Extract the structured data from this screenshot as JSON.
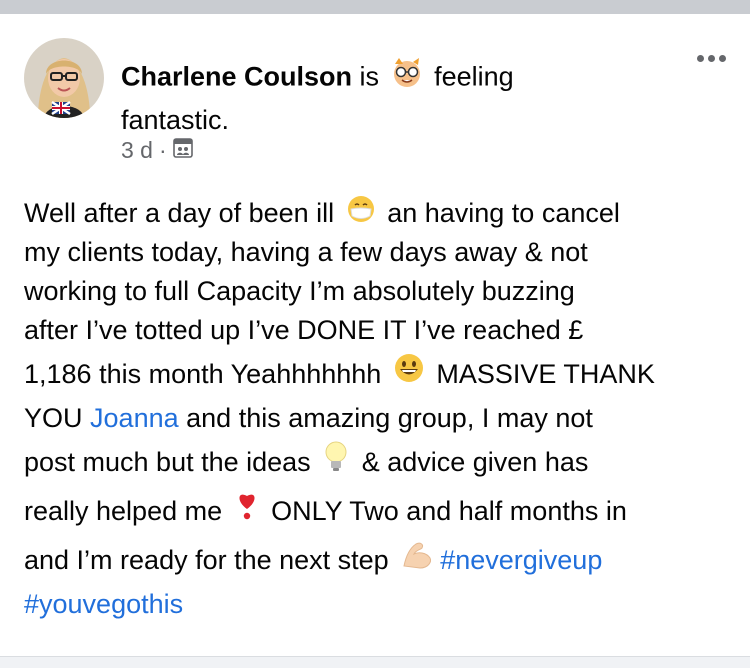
{
  "post": {
    "author": "Charlene Coulson",
    "status_prefix": "is",
    "status_activity_1": "feeling",
    "status_activity_2": "fantastic.",
    "time": "3 d",
    "dot": "·",
    "audience_icon": "group-audience-icon",
    "more_icon": "more-options-icon"
  },
  "body": {
    "l1_a": "Well after a day of been ill",
    "l1_b": "an having to cancel",
    "l2": "my clients today, having a few days away & not",
    "l3": "working to full Capacity I’m absolutely buzzing",
    "l4": "after I’ve totted up I’ve DONE IT I’ve  reached £",
    "l5_a": "1,186 this month Yeahhhhhhh",
    "l5_b": "MASSIVE THANK",
    "l6_a": "YOU",
    "l6_mention": "Joanna",
    "l6_b": "and this amazing group, I may not",
    "l7_a": "post much but the ideas",
    "l7_b": "& advice given has",
    "l8_a": "really helped me",
    "l8_b": "ONLY Two and half months in",
    "l9_a": "and I’m ready for the next step",
    "hashtag_1": "#nevergiveup",
    "hashtag_2": "#youvegothis"
  },
  "colors": {
    "link": "#216fdb",
    "meta": "#65676b",
    "text": "#050505"
  }
}
